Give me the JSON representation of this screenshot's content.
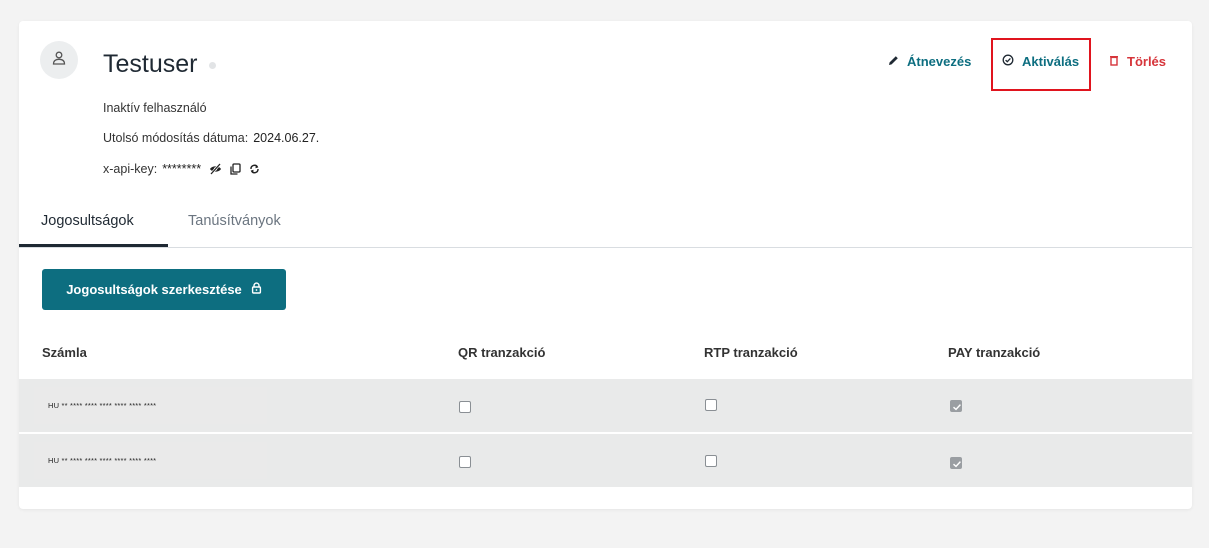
{
  "user": {
    "name": "Testuser",
    "status_text": "Inaktív felhasználó",
    "modified_label": "Utolsó módosítás dátuma:",
    "modified_value": "2024.06.27.",
    "apikey_label": "x-api-key:",
    "apikey_value": "********"
  },
  "actions": {
    "rename": "Átnevezés",
    "activate": "Aktiválás",
    "delete": "Törlés"
  },
  "tabs": [
    {
      "label": "Jogosultságok",
      "active": true
    },
    {
      "label": "Tanúsítványok",
      "active": false
    }
  ],
  "edit_permissions_button": "Jogosultságok szerkesztése",
  "table": {
    "headers": [
      "Számla",
      "QR tranzakció",
      "RTP tranzakció",
      "PAY tranzakció"
    ],
    "rows": [
      {
        "account": "HU ** **** **** **** **** **** ****",
        "qr": false,
        "rtp": false,
        "pay": true
      },
      {
        "account": "HU ** **** **** **** **** **** ****",
        "qr": false,
        "rtp": false,
        "pay": true
      }
    ]
  },
  "colors": {
    "primary": "#0d6e80",
    "danger": "#d6343a",
    "highlight": "#e0141e"
  },
  "icons": {
    "avatar": "user-icon",
    "rename": "pencil-icon",
    "activate": "check-circle-icon",
    "delete": "trash-icon",
    "apikey_toggle": "eye-off-icon",
    "apikey_copy": "copy-icon",
    "apikey_refresh": "refresh-icon",
    "edit_button": "lock-icon"
  }
}
